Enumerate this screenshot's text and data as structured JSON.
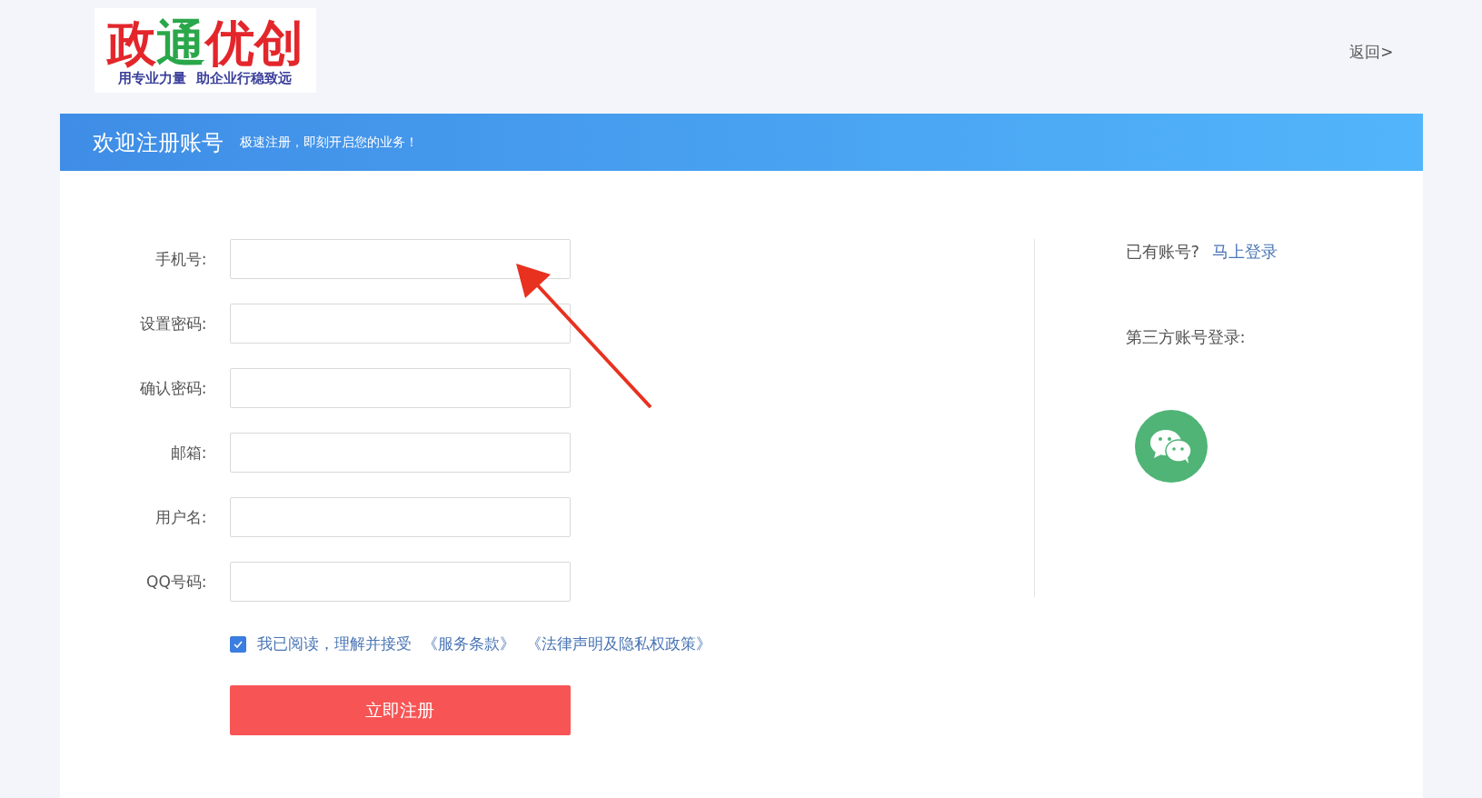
{
  "logo": {
    "chars": [
      {
        "text": "政",
        "color": "#e3262b"
      },
      {
        "text": "通",
        "color": "#2aa74a"
      },
      {
        "text": "优",
        "color": "#e3262b"
      },
      {
        "text": "创",
        "color": "#e3262b"
      }
    ],
    "slogan": "用专业力量  助企业行稳致远"
  },
  "back_link": "返回>",
  "banner": {
    "title": "欢迎注册账号",
    "subtitle": "极速注册，即刻开启您的业务！"
  },
  "form": {
    "fields": [
      {
        "label": "手机号:"
      },
      {
        "label": "设置密码:"
      },
      {
        "label": "确认密码:"
      },
      {
        "label": "邮箱:"
      },
      {
        "label": "用户名:"
      },
      {
        "label": "QQ号码:"
      }
    ],
    "agreement": {
      "checked": true,
      "text": "我已阅读，理解并接受",
      "links": [
        "《服务条款》",
        "《法律声明及隐私权政策》"
      ]
    },
    "submit": "立即注册"
  },
  "side": {
    "has_account": "已有账号?",
    "login_link": "马上登录",
    "third_party": "第三方账号登录:"
  }
}
